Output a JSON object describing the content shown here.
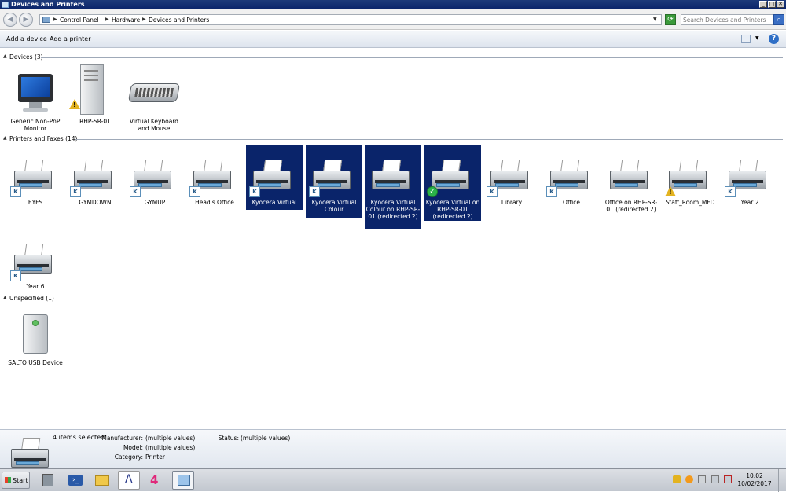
{
  "window": {
    "title": "Devices and Printers",
    "controls": {
      "minimize": "_",
      "maximize": "□",
      "close": "✕"
    }
  },
  "address": {
    "crumbs": [
      "Control Panel",
      "Hardware",
      "Devices and Printers"
    ],
    "search_placeholder": "Search Devices and Printers"
  },
  "commands": {
    "add_device": "Add a device",
    "add_printer": "Add a printer"
  },
  "groups": {
    "devices": "Devices (3)",
    "printers": "Printers and Faxes (14)",
    "unspecified": "Unspecified (1)"
  },
  "devices": [
    {
      "label": "Generic Non-PnP Monitor",
      "icon": "monitor-icon"
    },
    {
      "label": "RHP-SR-01",
      "icon": "server-tower-icon",
      "status": "warning"
    },
    {
      "label": "Virtual Keyboard and Mouse",
      "icon": "keyboard-icon"
    }
  ],
  "printers": [
    {
      "label": "EYFS",
      "selected": false,
      "badge": "kyocera"
    },
    {
      "label": "GYMDOWN",
      "selected": false,
      "badge": "kyocera"
    },
    {
      "label": "GYMUP",
      "selected": false,
      "badge": "kyocera"
    },
    {
      "label": "Head's Office",
      "selected": false,
      "badge": "kyocera"
    },
    {
      "label": "Kyocera Virtual",
      "selected": true,
      "badge": "kyocera"
    },
    {
      "label": "Kyocera Virtual Colour",
      "selected": true,
      "badge": "kyocera"
    },
    {
      "label": "Kyocera Virtual Colour on RHP-SR-01 (redirected 2)",
      "selected": true,
      "badge": "none"
    },
    {
      "label": "Kyocera Virtual on RHP-SR-01 (redirected 2)",
      "selected": true,
      "badge": "default-check"
    },
    {
      "label": "Library",
      "selected": false,
      "badge": "kyocera"
    },
    {
      "label": "Office",
      "selected": false,
      "badge": "kyocera"
    },
    {
      "label": "Office on RHP-SR-01 (redirected 2)",
      "selected": false,
      "badge": "none"
    },
    {
      "label": "Staff_Room_MFD",
      "selected": false,
      "badge": "warning"
    },
    {
      "label": "Year 2",
      "selected": false,
      "badge": "kyocera"
    },
    {
      "label": "Year 6",
      "selected": false,
      "badge": "kyocera"
    }
  ],
  "unspecified": [
    {
      "label": "SALTO USB Device",
      "icon": "usb-device-icon"
    }
  ],
  "details": {
    "selection": "4 items selected",
    "manufacturer_label": "Manufacturer:",
    "manufacturer_value": "(multiple values)",
    "model_label": "Model:",
    "model_value": "(multiple values)",
    "category_label": "Category:",
    "category_value": "Printer",
    "status_label": "Status:",
    "status_value": "(multiple values)"
  },
  "taskbar": {
    "start": "Start",
    "time": "10:02",
    "date": "10/02/2017"
  },
  "colors": {
    "selection": "#0a246a",
    "titlebar": "#0a246a",
    "warning": "#e3b320",
    "ok": "#2bb34a"
  }
}
